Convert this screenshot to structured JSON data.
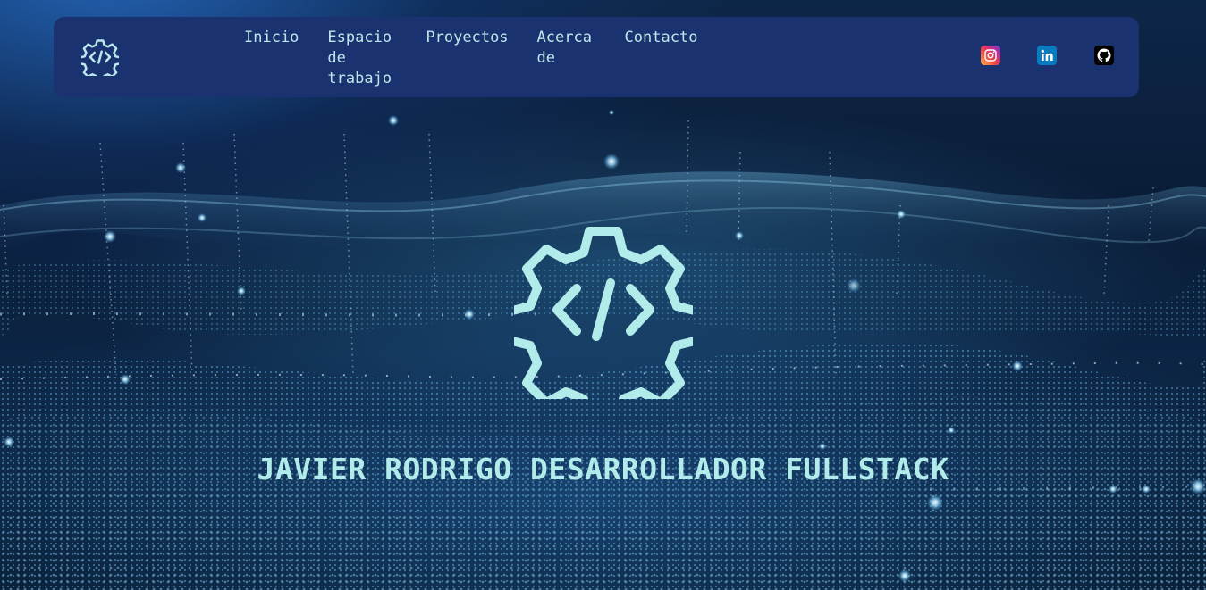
{
  "nav": {
    "items": [
      {
        "label": "Inicio"
      },
      {
        "label": "Espacio de trabajo"
      },
      {
        "label": "Proyectos"
      },
      {
        "label": "Acerca de"
      },
      {
        "label": "Contacto"
      }
    ],
    "social": [
      {
        "icon": "instagram-icon"
      },
      {
        "icon": "linkedin-icon"
      },
      {
        "icon": "github-icon"
      }
    ],
    "logo_icon": "code-gear-icon"
  },
  "hero": {
    "logo_icon": "code-gear-icon",
    "title": "JAVIER RODRIGO DESARROLLADOR FULLSTACK"
  },
  "colors": {
    "navbar_bg": "#1a3370",
    "accent": "#b2ecea",
    "nav_text": "#bfe6ea"
  }
}
